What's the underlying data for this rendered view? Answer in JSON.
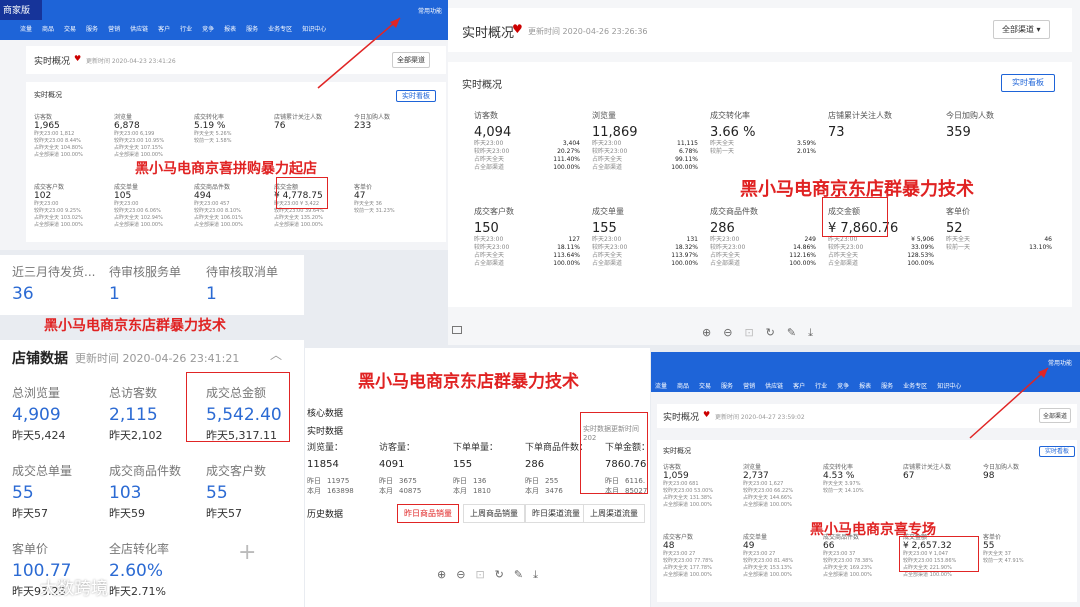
{
  "captions": {
    "c1": "黑小马电商京喜拼购暴力起店",
    "c2": "黑小马电商京东店群暴力技术",
    "c3": "黑小马电商京东店群暴力技术",
    "c4": "黑小马电商京东店群暴力技术",
    "c5": "黑小马电商京喜专场"
  },
  "tl": {
    "logo": "商家版",
    "nav": [
      "流量",
      "商品",
      "交易",
      "服务",
      "营销",
      "供应链",
      "客户",
      "行业",
      "竞争",
      "报表",
      "服务",
      "业务专区",
      "知识中心"
    ],
    "user": "常用功能",
    "title": "实时概况",
    "updated": "更新时间 2020-04-23 23:41:26",
    "channel": "全部渠道",
    "section": "实时概况",
    "btn": "实时看板",
    "row1": [
      {
        "label": "访客数",
        "value": "1,965",
        "lines": [
          "昨天23:00  1,812",
          "较昨天23:00  8.44%",
          "占昨天全天  104.80%",
          "占全部渠道  100.00%"
        ]
      },
      {
        "label": "浏览量",
        "value": "6,878",
        "lines": [
          "昨天23:00  6,199",
          "较昨天23:00  10.95%",
          "占昨天全天  107.15%",
          "占全部渠道  100.00%"
        ]
      },
      {
        "label": "成交转化率",
        "value": "5.19 %",
        "lines": [
          "昨天全天  5.26%",
          "较前一天  1.58%"
        ]
      },
      {
        "label": "店铺累计关注人数",
        "value": "76",
        "lines": []
      },
      {
        "label": "今日加购人数",
        "value": "233",
        "lines": []
      }
    ],
    "row2": [
      {
        "label": "成交客户数",
        "value": "102",
        "lines": [
          "昨天23:00",
          "较昨天23:00  9.25%",
          "占昨天全天  103.02%",
          "占全部渠道  100.00%"
        ]
      },
      {
        "label": "成交单量",
        "value": "105",
        "lines": [
          "昨天23:00",
          "较昨天23:00  6.06%",
          "占昨天全天  102.94%",
          "占全部渠道  100.00%"
        ]
      },
      {
        "label": "成交商品件数",
        "value": "494",
        "lines": [
          "昨天23:00  457",
          "较昨天23:00  8.10%",
          "占昨天全天  106.01%",
          "占全部渠道  100.00%"
        ]
      },
      {
        "label": "成交金额",
        "value": "¥ 4,778.75",
        "lines": [
          "昨天23:00  ¥ 3,422",
          "较昨天23:00  39.64%",
          "占昨天全天  135.20%",
          "占全部渠道  100.00%"
        ]
      },
      {
        "label": "客单价",
        "value": "47",
        "lines": [
          "昨天全天  36",
          "较前一天  31.23%"
        ]
      }
    ]
  },
  "tr": {
    "title": "实时概况",
    "updated": "更新时间 2020-04-26 23:26:36",
    "channel": "全部渠道",
    "section": "实时概况",
    "btn": "实时看板",
    "row1": [
      {
        "label": "访客数",
        "value": "4,094",
        "lines": [
          [
            "昨天23:00",
            "3,404"
          ],
          [
            "较昨天23:00",
            "20.27%"
          ],
          [
            "占昨天全天",
            "111.40%"
          ],
          [
            "占全部渠道",
            "100.00%"
          ]
        ]
      },
      {
        "label": "浏览量",
        "value": "11,869",
        "lines": [
          [
            "昨天23:00",
            "11,115"
          ],
          [
            "较昨天23:00",
            "6.78%"
          ],
          [
            "占昨天全天",
            "99.11%"
          ],
          [
            "占全部渠道",
            "100.00%"
          ]
        ]
      },
      {
        "label": "成交转化率",
        "value": "3.66 %",
        "lines": [
          [
            "昨天全天",
            "3.59%"
          ],
          [
            "较前一天",
            "2.01%"
          ]
        ]
      },
      {
        "label": "店铺累计关注人数",
        "value": "73",
        "lines": []
      },
      {
        "label": "今日加购人数",
        "value": "359",
        "lines": []
      }
    ],
    "row2": [
      {
        "label": "成交客户数",
        "value": "150",
        "lines": [
          [
            "昨天23:00",
            "127"
          ],
          [
            "较昨天23:00",
            "18.11%"
          ],
          [
            "占昨天全天",
            "113.64%"
          ],
          [
            "占全部渠道",
            "100.00%"
          ]
        ]
      },
      {
        "label": "成交单量",
        "value": "155",
        "lines": [
          [
            "昨天23:00",
            "131"
          ],
          [
            "较昨天23:00",
            "18.32%"
          ],
          [
            "占昨天全天",
            "113.97%"
          ],
          [
            "占全部渠道",
            "100.00%"
          ]
        ]
      },
      {
        "label": "成交商品件数",
        "value": "286",
        "lines": [
          [
            "昨天23:00",
            "249"
          ],
          [
            "较昨天23:00",
            "14.86%"
          ],
          [
            "占昨天全天",
            "112.16%"
          ],
          [
            "占全部渠道",
            "100.00%"
          ]
        ]
      },
      {
        "label": "成交金额",
        "value": "¥ 7,860.76",
        "lines": [
          [
            "昨天23:00",
            "¥ 5,906"
          ],
          [
            "较昨天23:00",
            "33.09%"
          ],
          [
            "占昨天全天",
            "128.53%"
          ],
          [
            "占全部渠道",
            "100.00%"
          ]
        ]
      },
      {
        "label": "客单价",
        "value": "52",
        "lines": [
          [
            "昨天全天",
            "46"
          ],
          [
            "较前一天",
            "13.10%"
          ]
        ]
      }
    ]
  },
  "pending": [
    {
      "label": "近三月待发货...",
      "value": "36"
    },
    {
      "label": "待审核服务单",
      "value": "1"
    },
    {
      "label": "待审核取消单",
      "value": "1"
    }
  ],
  "store": {
    "title": "店铺数据",
    "updated": "更新时间 2020-04-26 23:41:21",
    "items": [
      {
        "label": "总浏览量",
        "value": "4,909",
        "yd": "昨天5,424"
      },
      {
        "label": "总访客数",
        "value": "2,115",
        "yd": "昨天2,102"
      },
      {
        "label": "成交总金额",
        "value": "5,542.40",
        "yd": "昨天5,317.11"
      },
      {
        "label": "成交总单量",
        "value": "55",
        "yd": "昨天57"
      },
      {
        "label": "成交商品件数",
        "value": "103",
        "yd": "昨天59"
      },
      {
        "label": "成交客户数",
        "value": "55",
        "yd": "昨天57"
      },
      {
        "label": "客单价",
        "value": "100.77",
        "yd": "昨天93.28"
      },
      {
        "label": "全店转化率",
        "value": "2.60%",
        "yd": "昨天2.71%"
      }
    ],
    "watermark": "大数跨境"
  },
  "core": {
    "title": "核心数据",
    "section": "实时数据",
    "updated": "实时数据更新时间 202",
    "cols": [
      {
        "label": "浏览量：",
        "value": "11854",
        "l1": [
          "昨日",
          "11975"
        ],
        "l2": [
          "本月",
          "163898"
        ]
      },
      {
        "label": "访客量：",
        "value": "4091",
        "l1": [
          "昨日",
          "3675"
        ],
        "l2": [
          "本月",
          "40875"
        ]
      },
      {
        "label": "下单单量：",
        "value": "155",
        "l1": [
          "昨日",
          "136"
        ],
        "l2": [
          "本月",
          "1810"
        ]
      },
      {
        "label": "下单商品件数：",
        "value": "286",
        "l1": [
          "昨日",
          "255"
        ],
        "l2": [
          "本月",
          "3476"
        ]
      },
      {
        "label": "下单金额：",
        "value": "7860.76",
        "l1": [
          "昨日",
          "6116."
        ],
        "l2": [
          "本月",
          "85027"
        ]
      }
    ],
    "history": "历史数据",
    "tabs": [
      "昨日商品销量",
      "上周商品销量",
      "昨日渠道流量",
      "上周渠道流量"
    ]
  },
  "br": {
    "logo": "商家版",
    "nav": [
      "流量",
      "商品",
      "交易",
      "服务",
      "营销",
      "供应链",
      "客户",
      "行业",
      "竞争",
      "报表",
      "服务",
      "业务专区",
      "知识中心"
    ],
    "user": "常用功能",
    "title": "实时概况",
    "updated": "更新时间 2020-04-27 23:59:02",
    "channel": "全部渠道",
    "section": "实时概况",
    "btn": "实时看板",
    "row1": [
      {
        "label": "访客数",
        "value": "1,059",
        "lines": [
          "昨天23:00  681",
          "较昨天23:00  53.00%",
          "占昨天全天  131.38%",
          "占全部渠道  100.00%"
        ]
      },
      {
        "label": "浏览量",
        "value": "2,737",
        "lines": [
          "昨天23:00  1,627",
          "较昨天23:00  66.22%",
          "占昨天全天  144.66%",
          "占全部渠道  100.00%"
        ]
      },
      {
        "label": "成交转化率",
        "value": "4.53 %",
        "lines": [
          "昨天全天  3.97%",
          "较前一天  14.10%"
        ]
      },
      {
        "label": "店铺累计关注人数",
        "value": "67",
        "lines": []
      },
      {
        "label": "今日加购人数",
        "value": "98",
        "lines": []
      }
    ],
    "row2": [
      {
        "label": "成交客户数",
        "value": "48",
        "lines": [
          "昨天23:00  27",
          "较昨天23:00  77.78%",
          "占昨天全天  177.78%",
          "占全部渠道  100.00%"
        ]
      },
      {
        "label": "成交单量",
        "value": "49",
        "lines": [
          "昨天23:00  27",
          "较昨天23:00  81.48%",
          "占昨天全天  153.13%",
          "占全部渠道  100.00%"
        ]
      },
      {
        "label": "成交商品件数",
        "value": "66",
        "lines": [
          "昨天23:00  37",
          "较昨天23:00  78.38%",
          "占昨天全天  169.23%",
          "占全部渠道  100.00%"
        ]
      },
      {
        "label": "成交金额",
        "value": "¥ 2,657.32",
        "lines": [
          "昨天23:00  ¥ 1,047",
          "较昨天23:00  153.86%",
          "占昨天全天  221.90%",
          "占全部渠道  100.00%"
        ]
      },
      {
        "label": "客单价",
        "value": "55",
        "lines": [
          "昨天全天  37",
          "较前一天  47.91%"
        ]
      }
    ]
  }
}
